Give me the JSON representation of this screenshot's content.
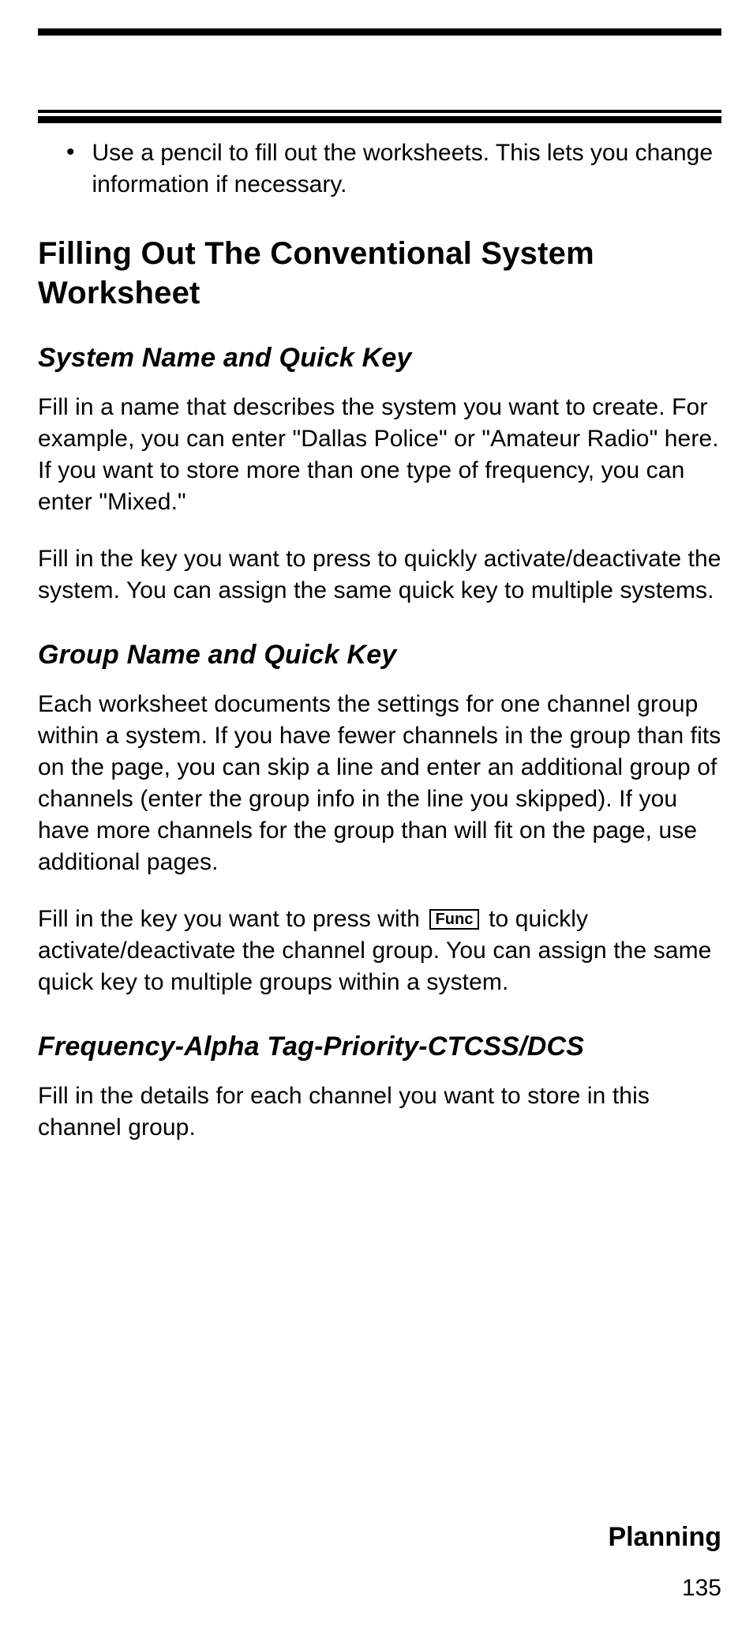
{
  "bullet": "Use a pencil to fill out the worksheets.  This lets you change information if necessary.",
  "h1": "Filling Out The Conventional System Worksheet",
  "sec1": {
    "title": "System Name and Quick Key",
    "p1": "Fill in a name that describes the system you want to create. For example, you can enter \"Dallas Police\" or \"Amateur Radio\" here. If you want to store more than one type of frequency, you can enter \"Mixed.\"",
    "p2": "Fill in the key you want to press to quickly activate/deactivate the system. You can assign the same quick key to multiple systems."
  },
  "sec2": {
    "title": "Group Name and Quick Key",
    "p1": "Each worksheet documents the settings for one channel group within a system. If you have fewer channels in the group than fits on the page, you can skip a line and enter an additional group of channels (enter the group info in the line you skipped). If you have more channels for the group than will fit on the page, use additional pages.",
    "p2a": "Fill in the key you want to press with ",
    "func": "Func",
    "p2b": " to quickly activate/deactivate the channel group. You can assign the same quick key to multiple groups within a system."
  },
  "sec3": {
    "title": "Frequency-Alpha Tag-Priority-CTCSS/DCS",
    "p1": "Fill in the details for each channel you want to store in this channel group."
  },
  "footer": {
    "section": "Planning",
    "page": "135"
  }
}
